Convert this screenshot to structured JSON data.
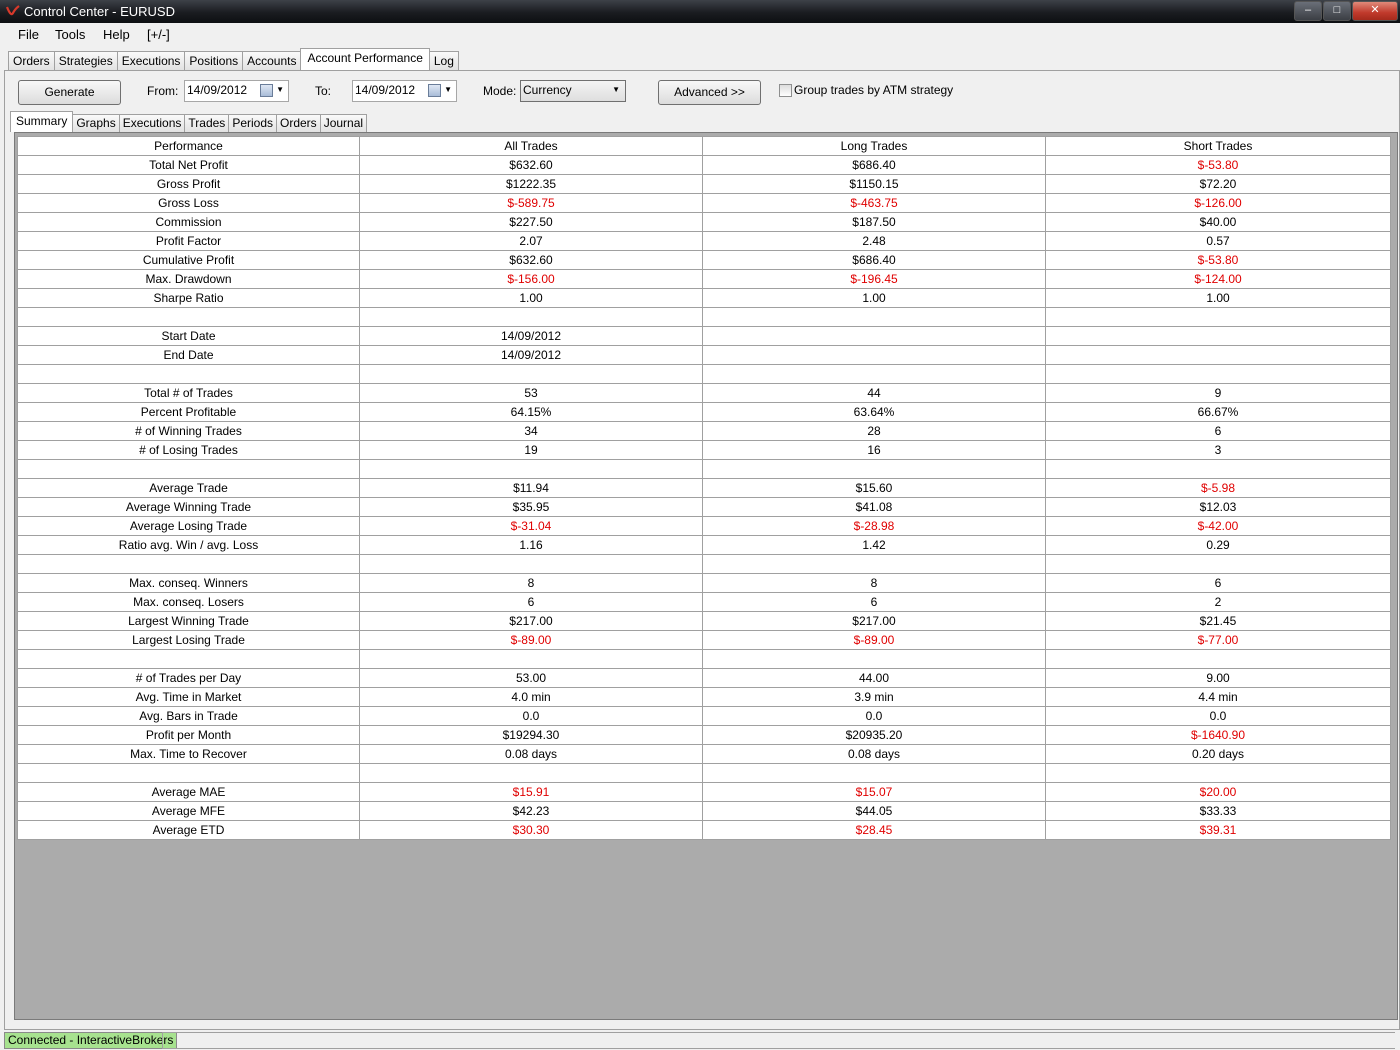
{
  "window": {
    "title": "Control Center - EURUSD"
  },
  "menu": [
    "File",
    "Tools",
    "Help",
    "[+/-]"
  ],
  "top_tabs": [
    {
      "label": "Orders",
      "active": false
    },
    {
      "label": "Strategies",
      "active": false
    },
    {
      "label": "Executions",
      "active": false
    },
    {
      "label": "Positions",
      "active": false
    },
    {
      "label": "Accounts",
      "active": false
    },
    {
      "label": "Account Performance",
      "active": true
    },
    {
      "label": "Log",
      "active": false
    }
  ],
  "toolbar": {
    "generate_label": "Generate",
    "from_label": "From:",
    "from_value": "14/09/2012",
    "to_label": "To:",
    "to_value": "14/09/2012",
    "mode_label": "Mode:",
    "mode_value": "Currency",
    "advanced_label": "Advanced >>",
    "group_label": "Group trades by ATM strategy",
    "group_checked": false
  },
  "sub_tabs": [
    {
      "label": "Summary",
      "active": true
    },
    {
      "label": "Graphs",
      "active": false
    },
    {
      "label": "Executions",
      "active": false
    },
    {
      "label": "Trades",
      "active": false
    },
    {
      "label": "Periods",
      "active": false
    },
    {
      "label": "Orders",
      "active": false
    },
    {
      "label": "Journal",
      "active": false
    }
  ],
  "table": {
    "columns": [
      "Performance",
      "All Trades",
      "Long Trades",
      "Short Trades"
    ],
    "negative_color": "#e00000",
    "rows": [
      [
        "Total Net Profit",
        "$632.60",
        "$686.40",
        "$-53.80"
      ],
      [
        "Gross Profit",
        "$1222.35",
        "$1150.15",
        "$72.20"
      ],
      [
        "Gross Loss",
        "$-589.75",
        "$-463.75",
        "$-126.00"
      ],
      [
        "Commission",
        "$227.50",
        "$187.50",
        "$40.00"
      ],
      [
        "Profit Factor",
        "2.07",
        "2.48",
        "0.57"
      ],
      [
        "Cumulative Profit",
        "$632.60",
        "$686.40",
        "$-53.80"
      ],
      [
        "Max. Drawdown",
        "$-156.00",
        "$-196.45",
        "$-124.00"
      ],
      [
        "Sharpe Ratio",
        "1.00",
        "1.00",
        "1.00"
      ],
      [
        "",
        "",
        "",
        ""
      ],
      [
        "Start Date",
        "14/09/2012",
        "",
        ""
      ],
      [
        "End Date",
        "14/09/2012",
        "",
        ""
      ],
      [
        "",
        "",
        "",
        ""
      ],
      [
        "Total # of Trades",
        "53",
        "44",
        "9"
      ],
      [
        "Percent Profitable",
        "64.15%",
        "63.64%",
        "66.67%"
      ],
      [
        "# of Winning Trades",
        "34",
        "28",
        "6"
      ],
      [
        "# of Losing Trades",
        "19",
        "16",
        "3"
      ],
      [
        "",
        "",
        "",
        ""
      ],
      [
        "Average Trade",
        "$11.94",
        "$15.60",
        "$-5.98"
      ],
      [
        "Average Winning Trade",
        "$35.95",
        "$41.08",
        "$12.03"
      ],
      [
        "Average Losing Trade",
        "$-31.04",
        "$-28.98",
        "$-42.00"
      ],
      [
        "Ratio avg. Win / avg. Loss",
        "1.16",
        "1.42",
        "0.29"
      ],
      [
        "",
        "",
        "",
        ""
      ],
      [
        "Max. conseq. Winners",
        "8",
        "8",
        "6"
      ],
      [
        "Max. conseq. Losers",
        "6",
        "6",
        "2"
      ],
      [
        "Largest Winning Trade",
        "$217.00",
        "$217.00",
        "$21.45"
      ],
      [
        "Largest Losing Trade",
        "$-89.00",
        "$-89.00",
        "$-77.00"
      ],
      [
        "",
        "",
        "",
        ""
      ],
      [
        "# of Trades per Day",
        "53.00",
        "44.00",
        "9.00"
      ],
      [
        "Avg. Time in Market",
        "4.0 min",
        "3.9 min",
        "4.4 min"
      ],
      [
        "Avg. Bars in Trade",
        "0.0",
        "0.0",
        "0.0"
      ],
      [
        "Profit per Month",
        "$19294.30",
        "$20935.20",
        "$-1640.90"
      ],
      [
        "Max. Time to Recover",
        "0.08 days",
        "0.08 days",
        "0.20 days"
      ],
      [
        "",
        "",
        "",
        ""
      ],
      [
        "Average MAE",
        "$15.91",
        "$15.07",
        "$20.00"
      ],
      [
        "Average MFE",
        "$42.23",
        "$44.05",
        "$33.33"
      ],
      [
        "Average ETD",
        "$30.30",
        "$28.45",
        "$39.31"
      ]
    ],
    "red_cells": [
      [
        0,
        3
      ],
      [
        2,
        1
      ],
      [
        2,
        2
      ],
      [
        2,
        3
      ],
      [
        5,
        3
      ],
      [
        6,
        1
      ],
      [
        6,
        2
      ],
      [
        6,
        3
      ],
      [
        17,
        3
      ],
      [
        19,
        1
      ],
      [
        19,
        2
      ],
      [
        19,
        3
      ],
      [
        25,
        1
      ],
      [
        25,
        2
      ],
      [
        25,
        3
      ],
      [
        30,
        3
      ],
      [
        33,
        1
      ],
      [
        33,
        2
      ],
      [
        33,
        3
      ],
      [
        35,
        1
      ],
      [
        35,
        2
      ],
      [
        35,
        3
      ]
    ]
  },
  "status": {
    "connection": "Connected - InteractiveBrokers"
  }
}
